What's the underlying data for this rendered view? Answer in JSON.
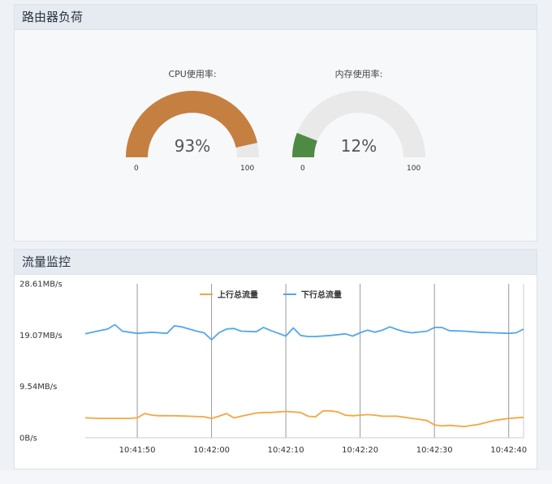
{
  "load_panel": {
    "title": "路由器负荷",
    "cpu": {
      "label": "CPU使用率:",
      "value_text": "93%",
      "value": 93,
      "min": "0",
      "max": "100",
      "color": "#c57f41"
    },
    "mem": {
      "label": "内存使用率:",
      "value_text": "12%",
      "value": 12,
      "min": "0",
      "max": "100",
      "color": "#4f8a44"
    },
    "track_color": "#e9e9e9"
  },
  "traffic_panel": {
    "title": "流量监控"
  },
  "chart_data": {
    "type": "line",
    "y_tick_labels": [
      "28.61MB/s",
      "19.07MB/s",
      "9.54MB/s",
      "0B/s"
    ],
    "y_ticks": [
      28.61,
      19.07,
      9.54,
      0
    ],
    "ylim": [
      0,
      28.61
    ],
    "x_tick_labels": [
      "10:41:50",
      "10:42:00",
      "10:42:10",
      "10:42:20",
      "10:42:30",
      "10:42:40"
    ],
    "x_tick_seconds": [
      50,
      60,
      70,
      80,
      90,
      100
    ],
    "xlim": [
      43,
      102
    ],
    "grid": false,
    "legend_position": "top-center",
    "series": [
      {
        "name": "上行总流量",
        "color": "#f7a541",
        "x": [
          43,
          45,
          47,
          49,
          50,
          51,
          52,
          53,
          55,
          57,
          59,
          60,
          61,
          62,
          63,
          64,
          66,
          67,
          68,
          70,
          71,
          72,
          73,
          74,
          75,
          76,
          77,
          78,
          79,
          80,
          81,
          82,
          83,
          85,
          86,
          87,
          88,
          89,
          90,
          91,
          92,
          94,
          96,
          98,
          100,
          102
        ],
        "values": [
          3.7,
          3.6,
          3.6,
          3.6,
          3.7,
          4.5,
          4.2,
          4.1,
          4.1,
          4.0,
          3.9,
          3.6,
          4.0,
          4.5,
          3.7,
          4.0,
          4.6,
          4.7,
          4.7,
          4.9,
          4.8,
          4.7,
          4.0,
          3.9,
          5.0,
          5.0,
          4.8,
          4.2,
          4.1,
          4.2,
          4.3,
          4.2,
          4.0,
          4.0,
          3.8,
          3.6,
          3.4,
          3.2,
          2.4,
          2.2,
          2.3,
          2.1,
          2.5,
          3.2,
          3.6,
          3.8
        ]
      },
      {
        "name": "下行总流量",
        "color": "#52a7ec",
        "x": [
          43,
          45,
          46,
          47,
          48,
          49,
          50,
          52,
          54,
          55,
          56,
          58,
          59,
          60,
          61,
          62,
          63,
          64,
          66,
          67,
          68,
          69,
          70,
          71,
          72,
          73,
          74,
          76,
          78,
          79,
          80,
          81,
          82,
          83,
          84,
          85,
          86,
          87,
          89,
          90,
          91,
          92,
          94,
          96,
          98,
          100,
          101,
          102
        ],
        "values": [
          19.3,
          19.9,
          20.2,
          21.0,
          19.8,
          19.6,
          19.4,
          19.6,
          19.4,
          20.8,
          20.6,
          19.8,
          19.5,
          18.2,
          19.5,
          20.2,
          20.3,
          19.8,
          19.7,
          20.5,
          19.9,
          19.4,
          18.9,
          20.4,
          19.0,
          18.8,
          18.8,
          19.0,
          19.3,
          18.9,
          19.5,
          20.0,
          19.6,
          20.0,
          20.6,
          20.1,
          19.7,
          19.5,
          19.8,
          20.5,
          20.5,
          19.9,
          19.8,
          19.6,
          19.5,
          19.4,
          19.5,
          20.2
        ]
      }
    ]
  }
}
